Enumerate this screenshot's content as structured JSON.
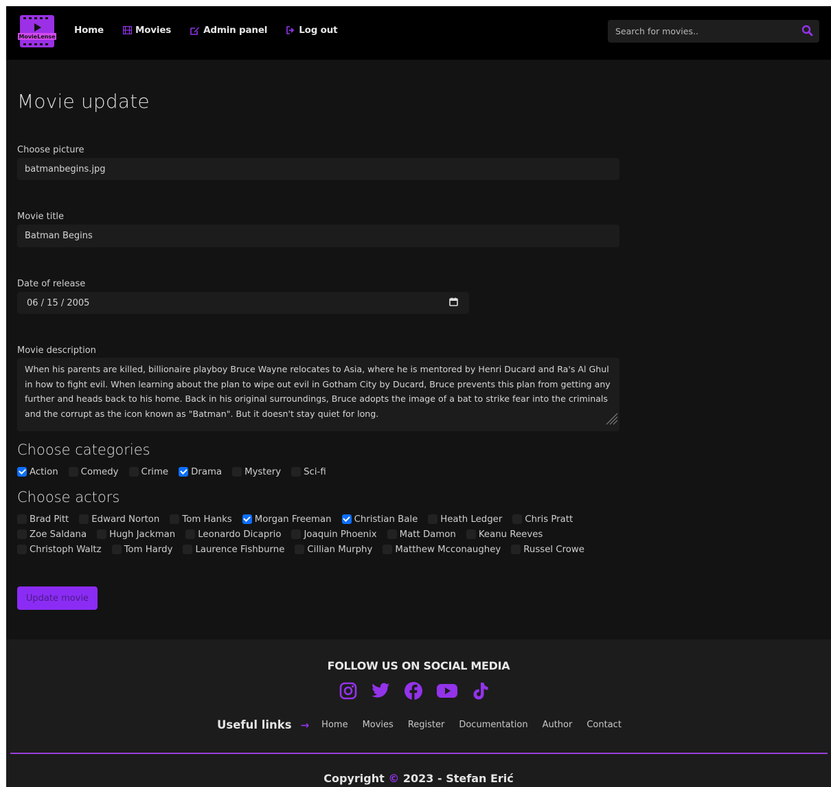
{
  "navbar": {
    "logo_text": "MovieLense",
    "links": [
      {
        "label": "Home"
      },
      {
        "label": "Movies"
      },
      {
        "label": "Admin panel"
      },
      {
        "label": "Log out"
      }
    ],
    "search_placeholder": "Search for movies.."
  },
  "page": {
    "title": "Movie update",
    "picture_label": "Choose picture",
    "picture_value": "batmanbegins.jpg",
    "title_label": "Movie title",
    "title_value": "Batman Begins",
    "date_label": "Date of release",
    "date_value": "06 / 15 / 2005",
    "description_label": "Movie description",
    "description_value": "When his parents are killed, billionaire playboy Bruce Wayne relocates to Asia, where he is mentored by Henri Ducard and Ra's Al Ghul in how to fight evil. When learning about the plan to wipe out evil in Gotham City by Ducard, Bruce prevents this plan from getting any further and heads back to his home. Back in his original surroundings, Bruce adopts the image of a bat to strike fear into the criminals and the corrupt as the icon known as \"Batman\". But it doesn't stay quiet for long.",
    "categories_title": "Choose categories",
    "categories": [
      {
        "label": "Action",
        "checked": true
      },
      {
        "label": "Comedy",
        "checked": false
      },
      {
        "label": "Crime",
        "checked": false
      },
      {
        "label": "Drama",
        "checked": true
      },
      {
        "label": "Mystery",
        "checked": false
      },
      {
        "label": "Sci-fi",
        "checked": false
      }
    ],
    "actors_title": "Choose actors",
    "actors": [
      {
        "label": "Brad Pitt",
        "checked": false
      },
      {
        "label": "Edward Norton",
        "checked": false
      },
      {
        "label": "Tom Hanks",
        "checked": false
      },
      {
        "label": "Morgan Freeman",
        "checked": true
      },
      {
        "label": "Christian Bale",
        "checked": true
      },
      {
        "label": "Heath Ledger",
        "checked": false
      },
      {
        "label": "Chris Pratt",
        "checked": false
      },
      {
        "label": "Zoe Saldana",
        "checked": false
      },
      {
        "label": "Hugh Jackman",
        "checked": false
      },
      {
        "label": "Leonardo Dicaprio",
        "checked": false
      },
      {
        "label": "Joaquin Phoenix",
        "checked": false
      },
      {
        "label": "Matt Damon",
        "checked": false
      },
      {
        "label": "Keanu Reeves",
        "checked": false
      },
      {
        "label": "Christoph Waltz",
        "checked": false
      },
      {
        "label": "Tom Hardy",
        "checked": false
      },
      {
        "label": "Laurence Fishburne",
        "checked": false
      },
      {
        "label": "Cillian Murphy",
        "checked": false
      },
      {
        "label": "Matthew Mcconaughey",
        "checked": false
      },
      {
        "label": "Russel Crowe",
        "checked": false
      }
    ],
    "submit_label": "Update movie"
  },
  "footer": {
    "follow_title": "FOLLOW US ON SOCIAL MEDIA",
    "socials": [
      "instagram-icon",
      "twitter-icon",
      "facebook-icon",
      "youtube-icon",
      "tiktok-icon"
    ],
    "useful_title": "Useful links",
    "links": [
      "Home",
      "Movies",
      "Register",
      "Documentation",
      "Author",
      "Contact"
    ],
    "copyright_prefix": "Copyright",
    "copyright_symbol": "©",
    "copyright_suffix": "2023 - Stefan Erić"
  },
  "colors": {
    "accent": "#9333ea",
    "button": "#8b2cf5",
    "checkbox": "#0d6efd",
    "background": "#131313",
    "navbar": "#000000",
    "footer": "#1c1c1c"
  }
}
